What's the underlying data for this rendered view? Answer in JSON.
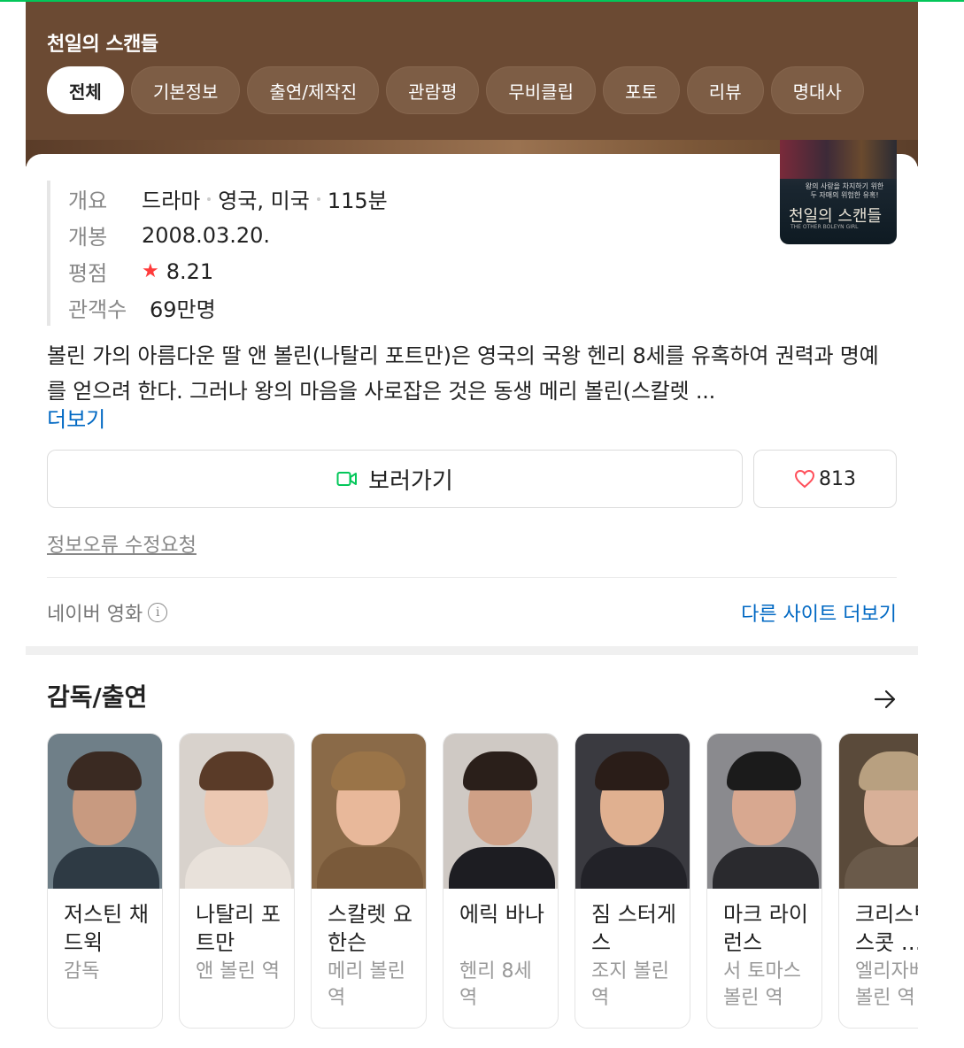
{
  "header": {
    "title": "천일의 스캔들",
    "tabs": [
      {
        "label": "전체",
        "active": true
      },
      {
        "label": "기본정보"
      },
      {
        "label": "출연/제작진"
      },
      {
        "label": "관람평"
      },
      {
        "label": "무비클립"
      },
      {
        "label": "포토"
      },
      {
        "label": "리뷰"
      },
      {
        "label": "명대사"
      }
    ],
    "bg_color": "#6b4a33"
  },
  "info": {
    "overview_key": "개요",
    "genre": "드라마",
    "country": "영국, 미국",
    "runtime": "115분",
    "release_key": "개봉",
    "release_date": "2008.03.20.",
    "rating_key": "평점",
    "rating": "8.21",
    "audience_key": "관객수",
    "audience": "69만명",
    "poster": {
      "tagline": "왕의 사랑을 차지하기 위한 두 자매의 위험한 유혹!",
      "title": "천일의 스캔들",
      "subtitle": "THE OTHER BOLEYN GIRL"
    },
    "synopsis": "볼린 가의 아름다운 딸 앤 볼린(나탈리 포트만)은 영국의 국왕 헨리 8세를 유혹하여 권력과 명예를 얻으려 한다. 그러나 왕의 마음을 사로잡은 것은 동생 메리 볼린(스칼렛 ...",
    "more_label": "더보기",
    "watch_label": "보러가기",
    "like_count": "813",
    "report_label": "정보오류 수정요청",
    "source_label": "네이버 영화",
    "other_sites_label": "다른 사이트 더보기"
  },
  "cast_section": {
    "title": "감독/출연",
    "members": [
      {
        "name": "저스틴 채드윅",
        "role": "감독",
        "skin": "#c89a80",
        "hair": "#3a2a22",
        "body": "#2e3a44",
        "bg": "#6f7f88"
      },
      {
        "name": "나탈리 포트만",
        "role": "앤 볼린 역",
        "skin": "#ecc8b2",
        "hair": "#5a3b28",
        "body": "#e8e1da",
        "bg": "#d8d2cc"
      },
      {
        "name": "스칼렛 요한슨",
        "role": "메리 볼린 역",
        "skin": "#e8b89a",
        "hair": "#9a7448",
        "body": "#7a5a3a",
        "bg": "#8a6a48"
      },
      {
        "name": "에릭 바나",
        "role": "헨리 8세 역",
        "skin": "#cfa086",
        "hair": "#2a1f1a",
        "body": "#1d1d22",
        "bg": "#cfc9c4"
      },
      {
        "name": "짐 스터게스",
        "role": "조지 볼린 역",
        "skin": "#e0b090",
        "hair": "#2a1d18",
        "body": "#222228",
        "bg": "#3a3a40"
      },
      {
        "name": "마크 라이런스",
        "role": "서 토마스 볼린 역",
        "skin": "#d8a890",
        "hair": "#1b1b1b",
        "body": "#2a2a2e",
        "bg": "#8a8a8e"
      },
      {
        "name": "크리스틴 스콧 …",
        "role": "엘리자베스 볼린 역",
        "skin": "#d8b098",
        "hair": "#b8a080",
        "body": "#6a5a4a",
        "bg": "#5a4a3a"
      }
    ]
  }
}
